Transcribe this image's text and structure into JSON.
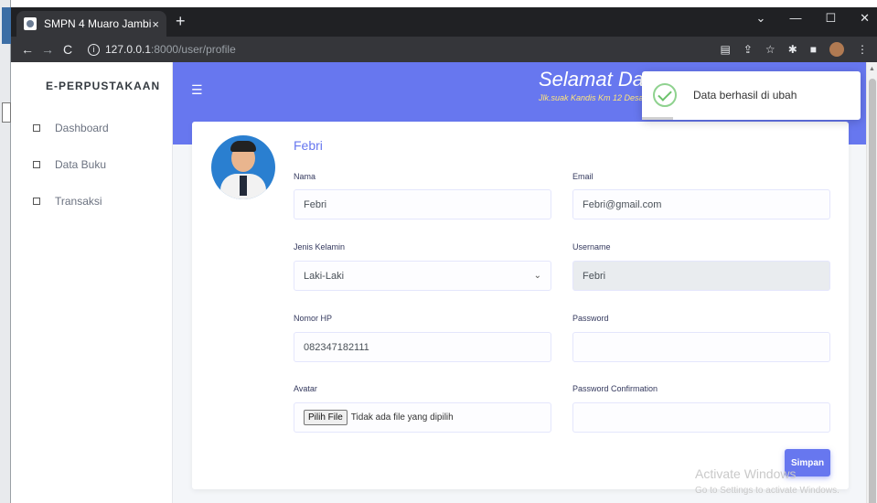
{
  "browser": {
    "tab_title": "SMPN 4 Muaro Jambi",
    "tab_close": "×",
    "new_tab": "+",
    "url_host": "127.0.0.1",
    "url_path": ":8000/user/profile",
    "win_min": "—",
    "win_max": "☐",
    "win_close": "✕",
    "win_down": "⌄"
  },
  "sidebar": {
    "brand": "E-PERPUSTAKAAN",
    "items": [
      {
        "label": "Dashboard"
      },
      {
        "label": "Data Buku"
      },
      {
        "label": "Transaksi"
      }
    ]
  },
  "header": {
    "welcome": "Selamat Datang",
    "address": "Jlk.suak Kandis Km 12 Desa"
  },
  "toast": {
    "message": "Data berhasil di ubah"
  },
  "profile": {
    "name": "Febri",
    "fields": {
      "nama": {
        "label": "Nama",
        "value": "Febri"
      },
      "email": {
        "label": "Email",
        "value": "Febri@gmail.com"
      },
      "jenis_kelamin": {
        "label": "Jenis Kelamin",
        "value": "Laki-Laki"
      },
      "username": {
        "label": "Username",
        "value": "Febri"
      },
      "nomor_hp": {
        "label": "Nomor HP",
        "value": "082347182111"
      },
      "password": {
        "label": "Password",
        "value": ""
      },
      "avatar": {
        "label": "Avatar",
        "button": "Pilih File",
        "status": "Tidak ada file yang dipilih"
      },
      "password_confirmation": {
        "label": "Password Confirmation",
        "value": ""
      }
    },
    "save_label": "Simpan"
  },
  "watermark": {
    "line1": "Activate Windows",
    "line2": "Go to Settings to activate Windows."
  }
}
